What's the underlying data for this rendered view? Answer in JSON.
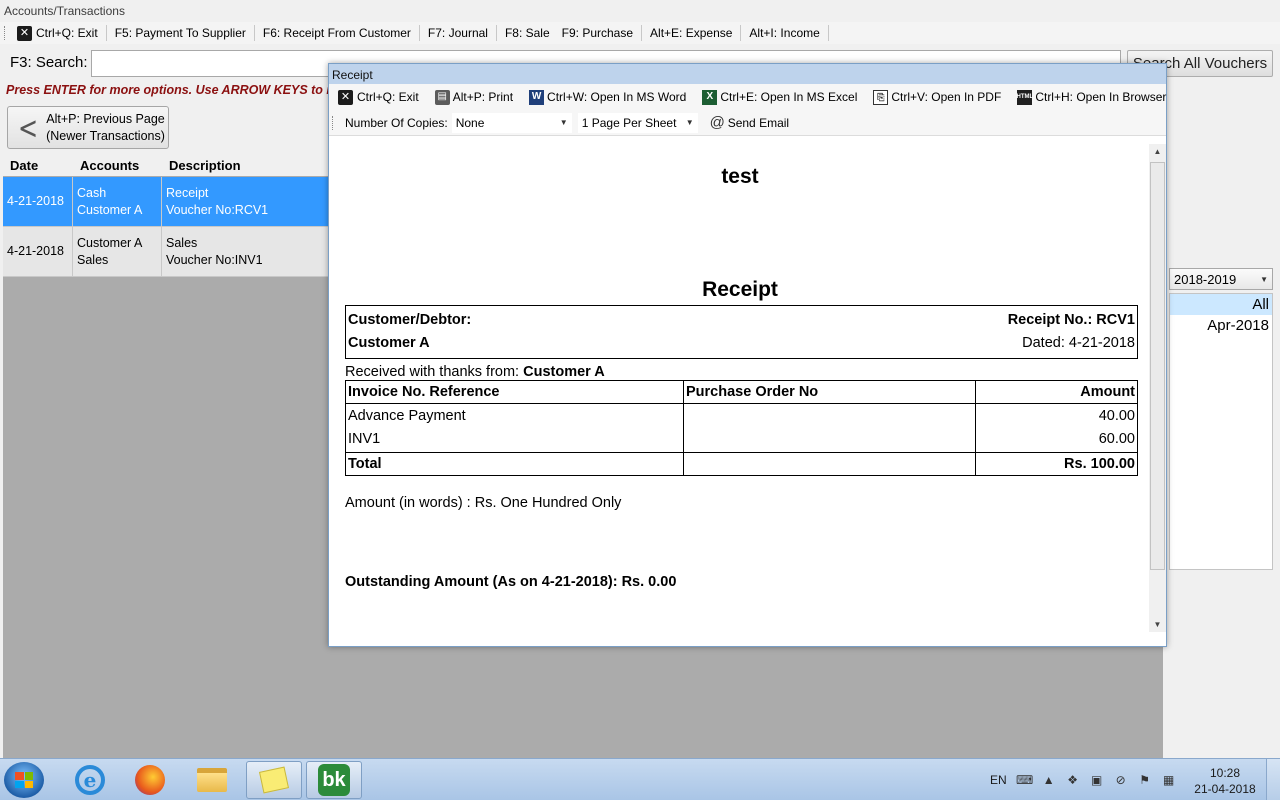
{
  "window": {
    "title": "Accounts/Transactions"
  },
  "toolbar": [
    {
      "label": "Ctrl+Q: Exit"
    },
    {
      "label": "F5: Payment To Supplier"
    },
    {
      "label": "F6: Receipt From Customer"
    },
    {
      "label": "F7: Journal"
    },
    {
      "label": "F8: Sale"
    },
    {
      "label": "F9: Purchase"
    },
    {
      "label": "Alt+E: Expense"
    },
    {
      "label": "Alt+I: Income"
    }
  ],
  "search": {
    "label": "F3: Search:",
    "value": "",
    "all_button": "Search All Vouchers"
  },
  "hint": "Press ENTER for more options. Use ARROW KEYS to navigate",
  "prev_page": {
    "line1": "Alt+P: Previous Page",
    "line2": "(Newer Transactions)"
  },
  "grid": {
    "headers": [
      "Date",
      "Accounts",
      "Description"
    ],
    "rows": [
      {
        "date": "4-21-2018",
        "accounts": [
          "Cash",
          "Customer A"
        ],
        "description": [
          "Receipt",
          "Voucher No:RCV1"
        ],
        "selected": true
      },
      {
        "date": "4-21-2018",
        "accounts": [
          "Customer A",
          "Sales"
        ],
        "description": [
          "Sales",
          "Voucher No:INV1"
        ],
        "selected": false
      }
    ]
  },
  "year_select": {
    "value": "2018-2019"
  },
  "periods": [
    {
      "label": "All",
      "selected": true
    },
    {
      "label": "Apr-2018",
      "selected": false
    }
  ],
  "dialog": {
    "title": "Receipt",
    "toolbar1": {
      "exit": "Ctrl+Q: Exit",
      "print": "Alt+P: Print",
      "word": "Ctrl+W: Open In MS Word",
      "excel": "Ctrl+E: Open In MS Excel",
      "pdf": "Ctrl+V: Open In PDF",
      "browser": "Ctrl+H: Open In Browser"
    },
    "toolbar2": {
      "copies_label": "Number Of Copies:",
      "copies_value": "None",
      "per_sheet_value": "1 Page Per Sheet",
      "send_email": "Send Email"
    }
  },
  "document": {
    "company": "test",
    "heading": "Receipt",
    "customer_label": "Customer/Debtor:",
    "customer_name": "Customer A",
    "receipt_no": "Receipt No.: RCV1",
    "dated": "Dated: 4-21-2018",
    "received_prefix": "Received with thanks from: ",
    "received_from": "Customer A",
    "table_headers": {
      "invoice": "Invoice No. Reference",
      "po": "Purchase Order No",
      "amount": "Amount"
    },
    "items": [
      {
        "invoice": "Advance Payment",
        "amount": "40.00"
      },
      {
        "invoice": "INV1",
        "amount": "60.00"
      }
    ],
    "total_label": "Total",
    "total_amount": "Rs. 100.00",
    "amount_words": "Amount (in words) : Rs. One Hundred Only",
    "outstanding": "Outstanding Amount (As on 4-21-2018): Rs. 0.00"
  },
  "taskbar": {
    "language": "EN",
    "time": "10:28",
    "date": "21-04-2018",
    "app_bk": "bk"
  }
}
